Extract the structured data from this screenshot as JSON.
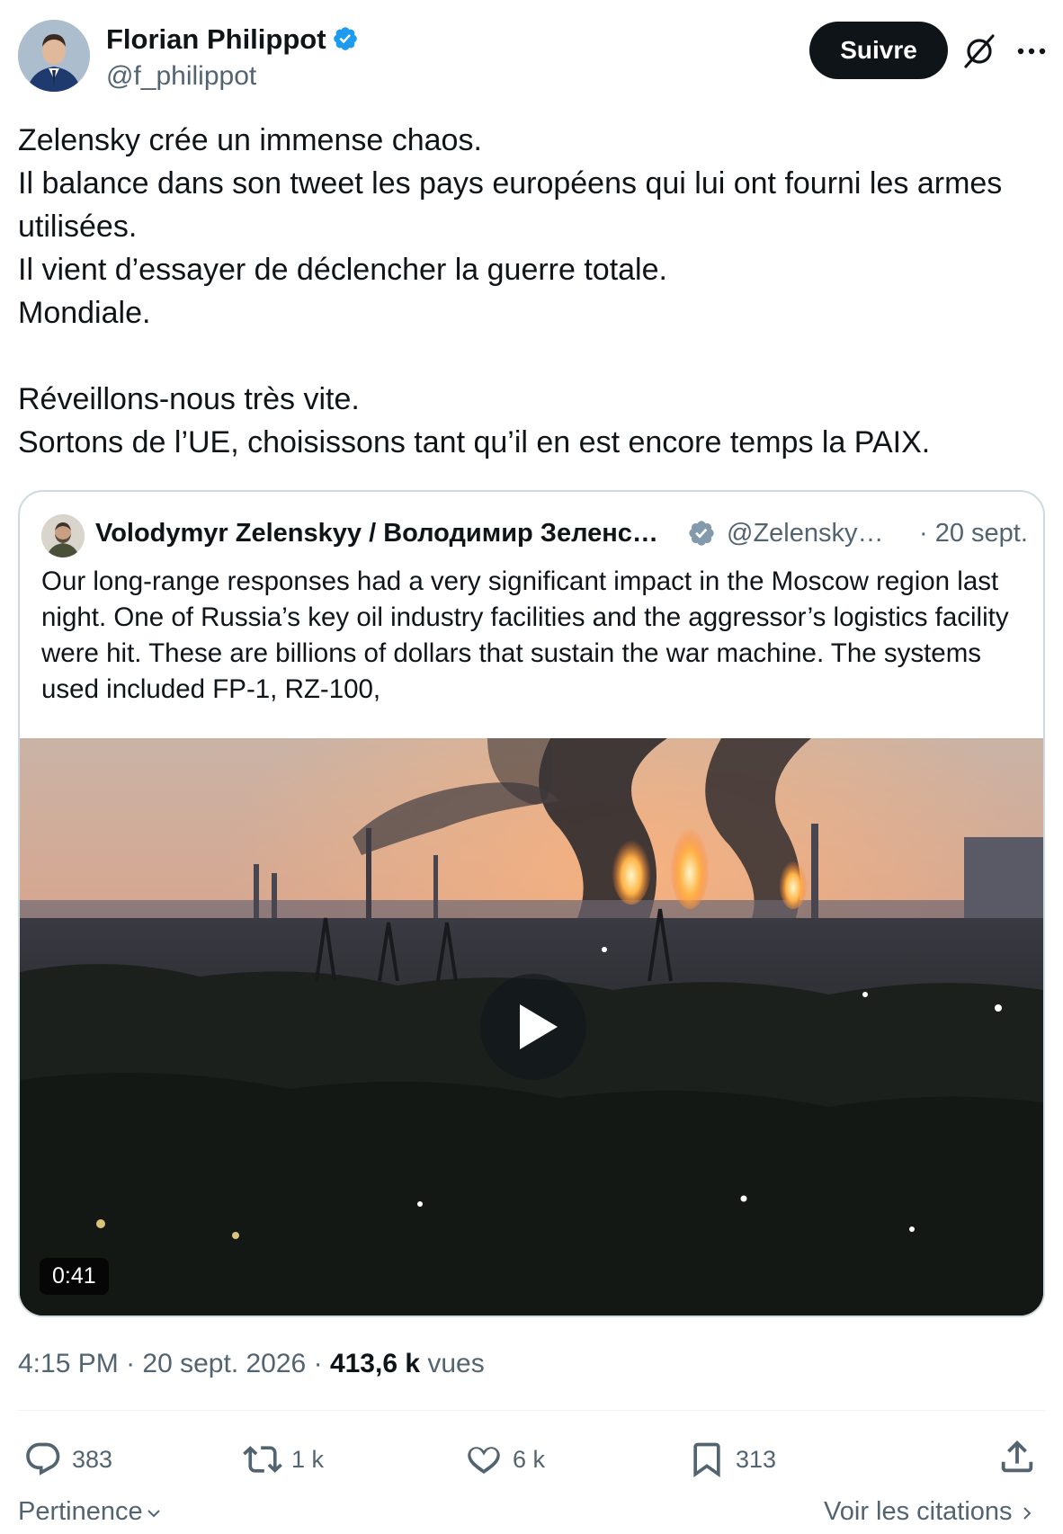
{
  "author": {
    "name": "Florian Philippot",
    "handle": "@f_philippot",
    "verified": true,
    "follow_label": "Suivre"
  },
  "tweet": {
    "lines": [
      "Zelensky crée un immense chaos.",
      "Il balance dans son tweet les pays européens qui lui ont fourni les armes utilisées.",
      "Il vient d’essayer de déclencher la guerre totale.",
      "Mondiale.",
      "Réveillons-nous très vite.",
      "Sortons de l’UE, choisissons tant qu’il en est encore temps la PAIX."
    ]
  },
  "quoted": {
    "name": "Volodymyr Zelenskyy / Володимир Зеленс…",
    "handle": "@Zelensky…",
    "date": "· 20 sept.",
    "text": "Our long-range responses had a very significant impact in the Moscow region last night. One of Russia’s key oil industry facilities and the aggressor’s logistics facility were hit. These are billions of dollars that sustain the war machine. The systems used included FP-1, RZ-100,",
    "video_duration": "0:41"
  },
  "meta": {
    "time": "4:15 PM",
    "sep": "·",
    "date": "20 sept. 2026",
    "views_count": "413,6 k",
    "views_label": "vues"
  },
  "actions": {
    "replies": "383",
    "reposts": "1 k",
    "likes": "6 k",
    "bookmarks": "313"
  },
  "footer": {
    "sort_label": "Pertinence",
    "quotes_label": "Voir les citations"
  },
  "colors": {
    "text": "#0f1419",
    "muted": "#536471",
    "border": "#cfd9de",
    "verified": "#1d9bf0",
    "verified_gray": "#829aab"
  }
}
